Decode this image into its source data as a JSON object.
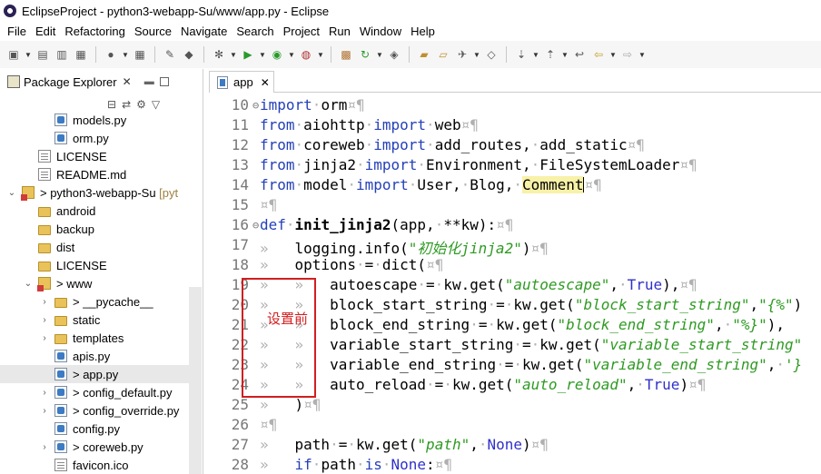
{
  "window": {
    "title": "EclipseProject - python3-webapp-Su/www/app.py - Eclipse"
  },
  "menu": [
    "File",
    "Edit",
    "Refactoring",
    "Source",
    "Navigate",
    "Search",
    "Project",
    "Run",
    "Window",
    "Help"
  ],
  "package_explorer": {
    "title": "Package Explorer",
    "tree": [
      {
        "label": "models.py",
        "icon": "python-file-icon",
        "indent": 2,
        "arrow": ""
      },
      {
        "label": "orm.py",
        "icon": "python-file-icon",
        "indent": 2,
        "arrow": ""
      },
      {
        "label": "LICENSE",
        "icon": "file-icon",
        "indent": 1,
        "arrow": ""
      },
      {
        "label": "README.md",
        "icon": "file-icon",
        "indent": 1,
        "arrow": ""
      },
      {
        "label": "> python3-webapp-Su",
        "suffix": " [pyt",
        "icon": "project-icon",
        "indent": 0,
        "arrow": "down"
      },
      {
        "label": "android",
        "icon": "folder-icon",
        "indent": 1,
        "arrow": ""
      },
      {
        "label": "backup",
        "icon": "folder-icon",
        "indent": 1,
        "arrow": ""
      },
      {
        "label": "dist",
        "icon": "folder-icon",
        "indent": 1,
        "arrow": ""
      },
      {
        "label": "LICENSE",
        "icon": "folder-icon",
        "indent": 1,
        "arrow": ""
      },
      {
        "label": "> www",
        "icon": "project-icon",
        "indent": 1,
        "arrow": "down"
      },
      {
        "label": "> __pycache__",
        "icon": "folder-icon",
        "indent": 2,
        "arrow": "right"
      },
      {
        "label": "static",
        "icon": "folder-icon",
        "indent": 2,
        "arrow": "right"
      },
      {
        "label": "templates",
        "icon": "folder-icon",
        "indent": 2,
        "arrow": "right"
      },
      {
        "label": "apis.py",
        "icon": "python-file-icon",
        "indent": 2,
        "arrow": ""
      },
      {
        "label": "> app.py",
        "icon": "python-file-error-icon",
        "indent": 2,
        "arrow": ""
      },
      {
        "label": "> config_default.py",
        "icon": "python-file-icon",
        "indent": 2,
        "arrow": "right"
      },
      {
        "label": "> config_override.py",
        "icon": "python-file-icon",
        "indent": 2,
        "arrow": "right"
      },
      {
        "label": "config.py",
        "icon": "python-file-icon",
        "indent": 2,
        "arrow": ""
      },
      {
        "label": "> coreweb.py",
        "icon": "python-file-icon",
        "indent": 2,
        "arrow": "right"
      },
      {
        "label": "favicon.ico",
        "icon": "image-file-icon",
        "indent": 2,
        "arrow": ""
      }
    ]
  },
  "editor": {
    "tab": "app",
    "lines": [
      {
        "n": "10",
        "fold": "⊖",
        "html": [
          [
            "kw",
            "import"
          ],
          [
            "ws",
            "·"
          ],
          [
            "",
            "orm"
          ],
          [
            "ws",
            "¤¶"
          ]
        ]
      },
      {
        "n": "11",
        "fold": "",
        "html": [
          [
            "kw",
            "from"
          ],
          [
            "ws",
            "·"
          ],
          [
            "",
            "aiohttp"
          ],
          [
            "ws",
            "·"
          ],
          [
            "kw",
            "import"
          ],
          [
            "ws",
            "·"
          ],
          [
            "",
            "web"
          ],
          [
            "ws",
            "¤¶"
          ]
        ]
      },
      {
        "n": "12",
        "fold": "",
        "html": [
          [
            "kw",
            "from"
          ],
          [
            "ws",
            "·"
          ],
          [
            "",
            "coreweb"
          ],
          [
            "ws",
            "·"
          ],
          [
            "kw",
            "import"
          ],
          [
            "ws",
            "·"
          ],
          [
            "",
            "add_routes,"
          ],
          [
            "ws",
            "·"
          ],
          [
            "",
            "add_static"
          ],
          [
            "ws",
            "¤¶"
          ]
        ]
      },
      {
        "n": "13",
        "fold": "",
        "html": [
          [
            "kw",
            "from"
          ],
          [
            "ws",
            "·"
          ],
          [
            "",
            "jinja2"
          ],
          [
            "ws",
            "·"
          ],
          [
            "kw",
            "import"
          ],
          [
            "ws",
            "·"
          ],
          [
            "",
            "Environment,"
          ],
          [
            "ws",
            "·"
          ],
          [
            "",
            "FileSystemLoader"
          ],
          [
            "ws",
            "¤¶"
          ]
        ]
      },
      {
        "n": "14",
        "fold": "",
        "html": [
          [
            "kw",
            "from"
          ],
          [
            "ws",
            "·"
          ],
          [
            "",
            "model"
          ],
          [
            "ws",
            "·"
          ],
          [
            "kw",
            "import"
          ],
          [
            "ws",
            "·"
          ],
          [
            "",
            "User,"
          ],
          [
            "ws",
            "·"
          ],
          [
            "",
            "Blog,"
          ],
          [
            "ws",
            "·"
          ],
          [
            "hl",
            "Comment"
          ],
          [
            "caret",
            ""
          ],
          [
            "ws",
            "¤¶"
          ]
        ]
      },
      {
        "n": "15",
        "fold": "",
        "html": [
          [
            "ws",
            "¤¶"
          ]
        ]
      },
      {
        "n": "16",
        "fold": "⊖",
        "html": [
          [
            "kw",
            "def"
          ],
          [
            "ws",
            "·"
          ],
          [
            "fnname",
            "init_jinja2"
          ],
          [
            "",
            "(app,"
          ],
          [
            "ws",
            "·"
          ],
          [
            "",
            "**kw):"
          ],
          [
            "ws",
            "¤¶"
          ]
        ]
      },
      {
        "n": "17",
        "fold": "",
        "html": [
          [
            "ws",
            "»   "
          ],
          [
            "",
            "logging.info("
          ],
          [
            "str",
            "\"初始化jinja2\""
          ],
          [
            "",
            ")"
          ],
          [
            "ws",
            "¤¶"
          ]
        ]
      },
      {
        "n": "18",
        "fold": "",
        "html": [
          [
            "ws",
            "»   "
          ],
          [
            "",
            "options"
          ],
          [
            "ws",
            "·"
          ],
          [
            "",
            "="
          ],
          [
            "ws",
            "·"
          ],
          [
            "",
            "dict("
          ],
          [
            "ws",
            "¤¶"
          ]
        ]
      },
      {
        "n": "19",
        "fold": "",
        "html": [
          [
            "ws",
            "»   »   "
          ],
          [
            "",
            "autoescape"
          ],
          [
            "ws",
            "·"
          ],
          [
            "",
            "="
          ],
          [
            "ws",
            "·"
          ],
          [
            "",
            "kw.get("
          ],
          [
            "str",
            "\"autoescape\""
          ],
          [
            "",
            ","
          ],
          [
            "ws",
            "·"
          ],
          [
            "const",
            "True"
          ],
          [
            "",
            "),"
          ],
          [
            "ws",
            "¤¶"
          ]
        ]
      },
      {
        "n": "20",
        "fold": "",
        "html": [
          [
            "ws",
            "»   »   "
          ],
          [
            "",
            "block_start_string"
          ],
          [
            "ws",
            "·"
          ],
          [
            "",
            "="
          ],
          [
            "ws",
            "·"
          ],
          [
            "",
            "kw.get("
          ],
          [
            "str",
            "\"block_start_string\""
          ],
          [
            "",
            ","
          ],
          [
            "str",
            "\"{%\""
          ],
          [
            "",
            ")"
          ]
        ]
      },
      {
        "n": "21",
        "fold": "",
        "html": [
          [
            "ws",
            "»   »   "
          ],
          [
            "",
            "block_end_string"
          ],
          [
            "ws",
            "·"
          ],
          [
            "",
            "="
          ],
          [
            "ws",
            "·"
          ],
          [
            "",
            "kw.get("
          ],
          [
            "str",
            "\"block_end_string\""
          ],
          [
            "",
            ","
          ],
          [
            "ws",
            "·"
          ],
          [
            "str",
            "\"%}\""
          ],
          [
            "",
            "),"
          ]
        ]
      },
      {
        "n": "22",
        "fold": "",
        "html": [
          [
            "ws",
            "»   »   "
          ],
          [
            "",
            "variable_start_string"
          ],
          [
            "ws",
            "·"
          ],
          [
            "",
            "="
          ],
          [
            "ws",
            "·"
          ],
          [
            "",
            "kw.get("
          ],
          [
            "str",
            "\"variable_start_string\""
          ]
        ]
      },
      {
        "n": "23",
        "fold": "",
        "html": [
          [
            "ws",
            "»   »   "
          ],
          [
            "",
            "variable_end_string"
          ],
          [
            "ws",
            "·"
          ],
          [
            "",
            "="
          ],
          [
            "ws",
            "·"
          ],
          [
            "",
            "kw.get("
          ],
          [
            "str",
            "\"variable_end_string\""
          ],
          [
            "",
            ","
          ],
          [
            "ws",
            "·"
          ],
          [
            "str",
            "'}"
          ]
        ]
      },
      {
        "n": "24",
        "fold": "",
        "html": [
          [
            "ws",
            "»   »   "
          ],
          [
            "",
            "auto_reload"
          ],
          [
            "ws",
            "·"
          ],
          [
            "",
            "="
          ],
          [
            "ws",
            "·"
          ],
          [
            "",
            "kw.get("
          ],
          [
            "str",
            "\"auto_reload\""
          ],
          [
            "",
            ","
          ],
          [
            "ws",
            "·"
          ],
          [
            "const",
            "True"
          ],
          [
            "",
            ")"
          ],
          [
            "ws",
            "¤¶"
          ]
        ]
      },
      {
        "n": "25",
        "fold": "",
        "html": [
          [
            "ws",
            "»   "
          ],
          [
            "",
            ")"
          ],
          [
            "ws",
            "¤¶"
          ]
        ]
      },
      {
        "n": "26",
        "fold": "",
        "html": [
          [
            "ws",
            "¤¶"
          ]
        ]
      },
      {
        "n": "27",
        "fold": "",
        "html": [
          [
            "ws",
            "»   "
          ],
          [
            "",
            "path"
          ],
          [
            "ws",
            "·"
          ],
          [
            "",
            "="
          ],
          [
            "ws",
            "·"
          ],
          [
            "",
            "kw.get("
          ],
          [
            "str",
            "\"path\""
          ],
          [
            "",
            ","
          ],
          [
            "ws",
            "·"
          ],
          [
            "const",
            "None"
          ],
          [
            "",
            ")"
          ],
          [
            "ws",
            "¤¶"
          ]
        ]
      },
      {
        "n": "28",
        "fold": "",
        "html": [
          [
            "ws",
            "»   "
          ],
          [
            "kw",
            "if"
          ],
          [
            "ws",
            "·"
          ],
          [
            "",
            "path"
          ],
          [
            "ws",
            "·"
          ],
          [
            "kw",
            "is"
          ],
          [
            "ws",
            "·"
          ],
          [
            "const",
            "None"
          ],
          [
            "",
            ":"
          ],
          [
            "ws",
            "¤¶"
          ]
        ]
      }
    ]
  },
  "annotation": {
    "text": "设置前",
    "color": "#d11e1e"
  }
}
